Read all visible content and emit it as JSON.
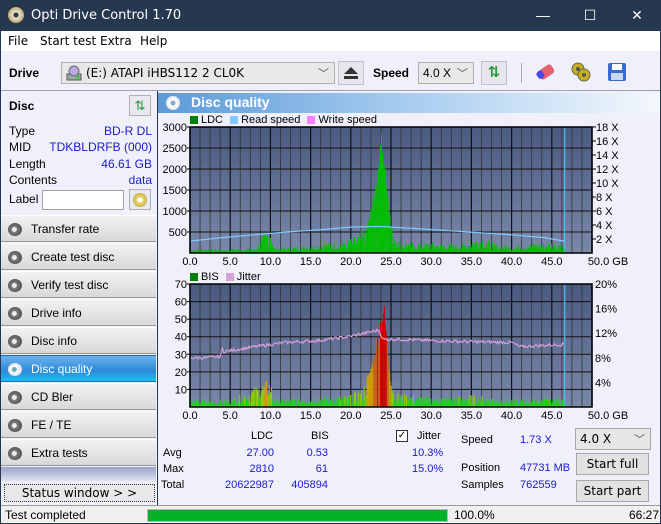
{
  "window": {
    "title": "Opti Drive Control 1.70",
    "minimize": "—",
    "maximize": "☐",
    "close": "✕"
  },
  "menu": [
    "File",
    "Start test",
    "Extra",
    "Help"
  ],
  "toolbar": {
    "drive_label": "Drive",
    "drive_value": "(E:)  ATAPI iHBS112   2 CL0K",
    "speed_label": "Speed",
    "speed_value": "4.0 X",
    "icons": [
      "eject-icon",
      "refresh-icon",
      "erase-icon",
      "settings-icon",
      "save-icon"
    ]
  },
  "disc": {
    "header": "Disc",
    "type_label": "Type",
    "type": "BD-R DL",
    "mid_label": "MID",
    "mid": "TDKBLDRFB (000)",
    "length_label": "Length",
    "length": "46.61 GB",
    "contents_label": "Contents",
    "contents": "data",
    "label_label": "Label",
    "label_value": ""
  },
  "nav": [
    {
      "label": "Transfer rate",
      "active": false
    },
    {
      "label": "Create test disc",
      "active": false
    },
    {
      "label": "Verify test disc",
      "active": false
    },
    {
      "label": "Drive info",
      "active": false
    },
    {
      "label": "Disc info",
      "active": false
    },
    {
      "label": "Disc quality",
      "active": true
    },
    {
      "label": "CD Bler",
      "active": false
    },
    {
      "label": "FE / TE",
      "active": false
    },
    {
      "label": "Extra tests",
      "active": false
    }
  ],
  "status_window_button": "Status window > >",
  "panel_title": "Disc quality",
  "colors": {
    "ldc": "#00c000",
    "read_speed": "#80c8ff",
    "write_speed": "#ff80ff",
    "bis": "#00c000",
    "jitter": "#d8a0d8",
    "plot_bg": "#5a6a8e",
    "accent": "#2a8ad8"
  },
  "chart_data": [
    {
      "type": "bar",
      "title": "LDC / Read speed",
      "legend": [
        "LDC",
        "Read speed",
        "Write speed"
      ],
      "legend_placement": "top-left",
      "xlabel": "GB",
      "x_ticks": [
        "0.0",
        "5.0",
        "10.0",
        "15.0",
        "20.0",
        "25.0",
        "30.0",
        "35.0",
        "40.0",
        "45.0",
        "50.0 GB"
      ],
      "xlim": [
        0,
        50
      ],
      "y_left_ticks": [
        "500",
        "1000",
        "1500",
        "2000",
        "2500",
        "3000"
      ],
      "ylim_left": [
        0,
        3000
      ],
      "y_right_ticks": [
        "2 X",
        "4 X",
        "6 X",
        "8 X",
        "10 X",
        "12 X",
        "14 X",
        "16 X",
        "18 X"
      ],
      "ylim_right": [
        0,
        18
      ],
      "grid": true,
      "end_marker_gb": 46.61,
      "ldc_profile": [
        [
          0,
          80
        ],
        [
          2,
          90
        ],
        [
          4,
          80
        ],
        [
          6,
          100
        ],
        [
          8,
          90
        ],
        [
          10,
          600
        ],
        [
          10.3,
          120
        ],
        [
          12,
          110
        ],
        [
          14,
          150
        ],
        [
          16,
          200
        ],
        [
          18,
          220
        ],
        [
          20,
          300
        ],
        [
          21,
          400
        ],
        [
          22,
          600
        ],
        [
          22.5,
          1100
        ],
        [
          23,
          1700
        ],
        [
          23.5,
          2400
        ],
        [
          23.8,
          2810
        ],
        [
          24.2,
          2200
        ],
        [
          24.6,
          1400
        ],
        [
          25,
          600
        ],
        [
          26,
          250
        ],
        [
          28,
          200
        ],
        [
          30,
          220
        ],
        [
          32,
          180
        ],
        [
          34,
          200
        ],
        [
          36,
          350
        ],
        [
          38,
          180
        ],
        [
          40,
          160
        ],
        [
          42,
          200
        ],
        [
          44,
          220
        ],
        [
          46,
          250
        ],
        [
          46.61,
          150
        ]
      ],
      "read_speed_x": [
        [
          0,
          1.7
        ],
        [
          4,
          2.2
        ],
        [
          8,
          2.6
        ],
        [
          12,
          3.0
        ],
        [
          16,
          3.3
        ],
        [
          20,
          3.7
        ],
        [
          23.5,
          3.8
        ],
        [
          28,
          3.5
        ],
        [
          32,
          3.2
        ],
        [
          36,
          2.9
        ],
        [
          40,
          2.6
        ],
        [
          44,
          2.2
        ],
        [
          46.61,
          1.7
        ]
      ]
    },
    {
      "type": "bar",
      "title": "BIS / Jitter",
      "legend": [
        "BIS",
        "Jitter"
      ],
      "legend_placement": "top-left",
      "xlabel": "GB",
      "x_ticks": [
        "0.0",
        "5.0",
        "10.0",
        "15.0",
        "20.0",
        "25.0",
        "30.0",
        "35.0",
        "40.0",
        "45.0",
        "50.0 GB"
      ],
      "xlim": [
        0,
        50
      ],
      "y_left_ticks": [
        "10",
        "20",
        "30",
        "40",
        "50",
        "60",
        "70"
      ],
      "ylim_left": [
        0,
        70
      ],
      "y_right_ticks": [
        "4%",
        "8%",
        "12%",
        "16%",
        "20%"
      ],
      "ylim_right": [
        0,
        20
      ],
      "grid": true,
      "end_marker_gb": 46.61,
      "bis_profile": [
        [
          0,
          3
        ],
        [
          5,
          3
        ],
        [
          10,
          12
        ],
        [
          10.3,
          3
        ],
        [
          15,
          4
        ],
        [
          20,
          5
        ],
        [
          21.5,
          8
        ],
        [
          22,
          15
        ],
        [
          22.5,
          25
        ],
        [
          23,
          35
        ],
        [
          23.5,
          48
        ],
        [
          24,
          61
        ],
        [
          24.4,
          45
        ],
        [
          24.8,
          20
        ],
        [
          25.3,
          6
        ],
        [
          30,
          4
        ],
        [
          35,
          5
        ],
        [
          40,
          3
        ],
        [
          45,
          4
        ],
        [
          46.61,
          3
        ]
      ],
      "jitter_pct": [
        [
          0,
          8.0
        ],
        [
          2,
          8.0
        ],
        [
          3.8,
          8.2
        ],
        [
          4,
          9.6
        ],
        [
          4.2,
          9.0
        ],
        [
          8,
          9.8
        ],
        [
          12,
          10.5
        ],
        [
          16,
          10.8
        ],
        [
          20,
          11.5
        ],
        [
          23.5,
          12.5
        ],
        [
          24,
          11.0
        ],
        [
          26,
          11.0
        ],
        [
          30,
          10.8
        ],
        [
          35,
          10.6
        ],
        [
          40,
          10.5
        ],
        [
          41,
          9.8
        ],
        [
          46.61,
          10.2
        ]
      ]
    }
  ],
  "stats": {
    "col_ldc": "LDC",
    "col_bis": "BIS",
    "avg_label": "Avg",
    "max_label": "Max",
    "total_label": "Total",
    "ldc_avg": "27.00",
    "ldc_max": "2810",
    "ldc_total": "20622987",
    "bis_avg": "0.53",
    "bis_max": "61",
    "bis_total": "405894",
    "jitter_label": "Jitter",
    "jitter_checked": true,
    "jitter_avg": "10.3%",
    "jitter_max": "15.0%",
    "speed_label": "Speed",
    "speed_value": "1.73 X",
    "position_label": "Position",
    "position_value": "47731 MB",
    "samples_label": "Samples",
    "samples_value": "762559",
    "speed_select": "4.0 X",
    "start_full": "Start full",
    "start_part": "Start part"
  },
  "status": {
    "text": "Test completed",
    "progress": 100.0,
    "progress_text": "100.0%",
    "time": "66:27"
  }
}
